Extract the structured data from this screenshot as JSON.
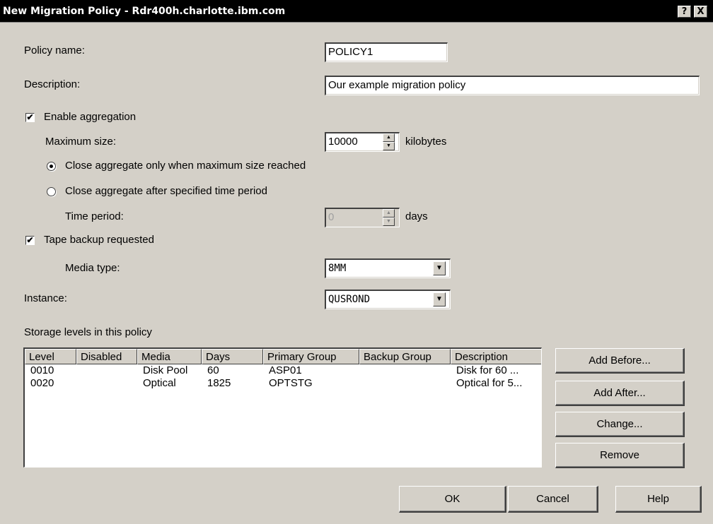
{
  "window": {
    "title": "New Migration Policy - Rdr400h.charlotte.ibm.com",
    "help_glyph": "?",
    "close_glyph": "X"
  },
  "form": {
    "policy_name_label": "Policy name:",
    "policy_name_value": "POLICY1",
    "description_label": "Description:",
    "description_value": "Our example migration policy",
    "enable_aggregation_label": "Enable aggregation",
    "enable_aggregation_checked": true,
    "max_size_label": "Maximum size:",
    "max_size_value": "10000",
    "max_size_unit": "kilobytes",
    "radio_close_max_label": "Close aggregate only when maximum size reached",
    "radio_close_time_label": "Close aggregate after specified time period",
    "time_period_label": "Time period:",
    "time_period_value": "0",
    "time_period_unit": "days",
    "tape_backup_label": "Tape backup requested",
    "tape_backup_checked": true,
    "media_type_label": "Media type:",
    "media_type_value": "8MM",
    "instance_label": "Instance:",
    "instance_value": "QUSROND"
  },
  "storage": {
    "section_label": "Storage levels in this policy",
    "columns": [
      "Level",
      "Disabled",
      "Media",
      "Days",
      "Primary Group",
      "Backup Group",
      "Description"
    ],
    "rows": [
      [
        "0010",
        "",
        "Disk Pool",
        "60",
        "ASP01",
        "",
        "Disk for 60 ..."
      ],
      [
        "0020",
        "",
        "Optical",
        "1825",
        "OPTSTG",
        "",
        "Optical for 5..."
      ]
    ]
  },
  "buttons": {
    "add_before": "Add Before...",
    "add_after": "Add After...",
    "change": "Change...",
    "remove": "Remove",
    "ok": "OK",
    "cancel": "Cancel",
    "help": "Help"
  }
}
